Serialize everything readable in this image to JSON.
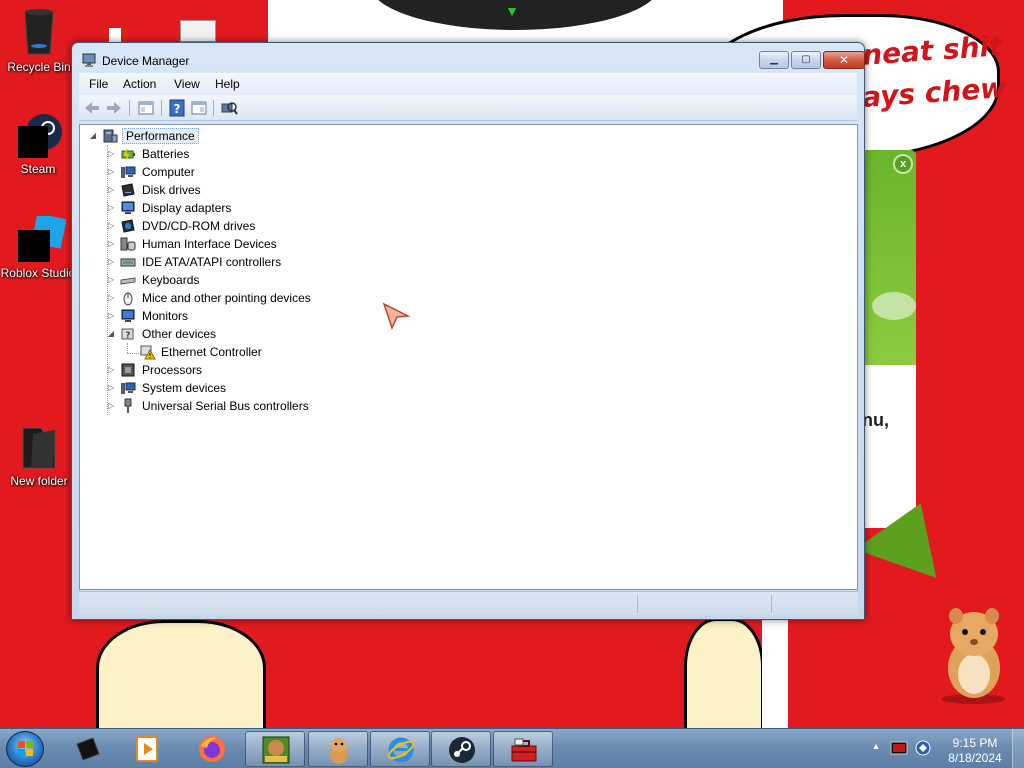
{
  "desktop": {
    "icons": [
      {
        "label": "Recycle Bin",
        "icon": "recycle-bin-icon"
      },
      {
        "label": "Steam",
        "icon": "steam-icon"
      },
      {
        "label": "Roblox Studio",
        "icon": "roblox-studio-icon"
      },
      {
        "label": "New folder",
        "icon": "folder-icon"
      }
    ],
    "wallpaper_text": {
      "line1": "neat shit",
      "line2": "ays chew"
    },
    "popup_text": "nu,"
  },
  "window": {
    "title": "Device Manager",
    "menu": [
      "File",
      "Action",
      "View",
      "Help"
    ],
    "toolbar": [
      "back-icon",
      "forward-icon",
      "show-hide-console-tree-icon",
      "help-icon",
      "properties-icon",
      "scan-hardware-icon"
    ],
    "tree": {
      "root": "Performance",
      "categories": [
        {
          "label": "Batteries",
          "icon": "battery-icon",
          "expanded": false
        },
        {
          "label": "Computer",
          "icon": "computer-icon",
          "expanded": false
        },
        {
          "label": "Disk drives",
          "icon": "disk-drive-icon",
          "expanded": false
        },
        {
          "label": "Display adapters",
          "icon": "display-adapter-icon",
          "expanded": false
        },
        {
          "label": "DVD/CD-ROM drives",
          "icon": "dvd-drive-icon",
          "expanded": false
        },
        {
          "label": "Human Interface Devices",
          "icon": "hid-icon",
          "expanded": false
        },
        {
          "label": "IDE ATA/ATAPI controllers",
          "icon": "ide-controller-icon",
          "expanded": false
        },
        {
          "label": "Keyboards",
          "icon": "keyboard-icon",
          "expanded": false
        },
        {
          "label": "Mice and other pointing devices",
          "icon": "mouse-icon",
          "expanded": false
        },
        {
          "label": "Monitors",
          "icon": "monitor-icon",
          "expanded": false
        },
        {
          "label": "Other devices",
          "icon": "unknown-device-icon",
          "expanded": true
        },
        {
          "label": "Processors",
          "icon": "processor-icon",
          "expanded": false
        },
        {
          "label": "System devices",
          "icon": "system-device-icon",
          "expanded": false
        },
        {
          "label": "Universal Serial Bus controllers",
          "icon": "usb-icon",
          "expanded": false
        }
      ],
      "other_devices_children": [
        {
          "label": "Ethernet Controller",
          "icon": "warning-device-icon"
        }
      ]
    }
  },
  "taskbar": {
    "items": [
      {
        "name": "start-button",
        "icon": "windows-orb-icon"
      },
      {
        "name": "roblox-pinned",
        "icon": "roblox-icon"
      },
      {
        "name": "media-pinned",
        "icon": "media-player-icon"
      },
      {
        "name": "firefox-pinned",
        "icon": "firefox-icon"
      },
      {
        "name": "bonzi-running",
        "icon": "bonzi-box-icon"
      },
      {
        "name": "hamster-running",
        "icon": "hamster-icon"
      },
      {
        "name": "ie-running",
        "icon": "internet-explorer-icon"
      },
      {
        "name": "steam-running",
        "icon": "steam-icon"
      },
      {
        "name": "device-manager-running",
        "icon": "toolbox-icon"
      }
    ],
    "clock": {
      "time": "9:15 PM",
      "date": "8/18/2024"
    }
  }
}
